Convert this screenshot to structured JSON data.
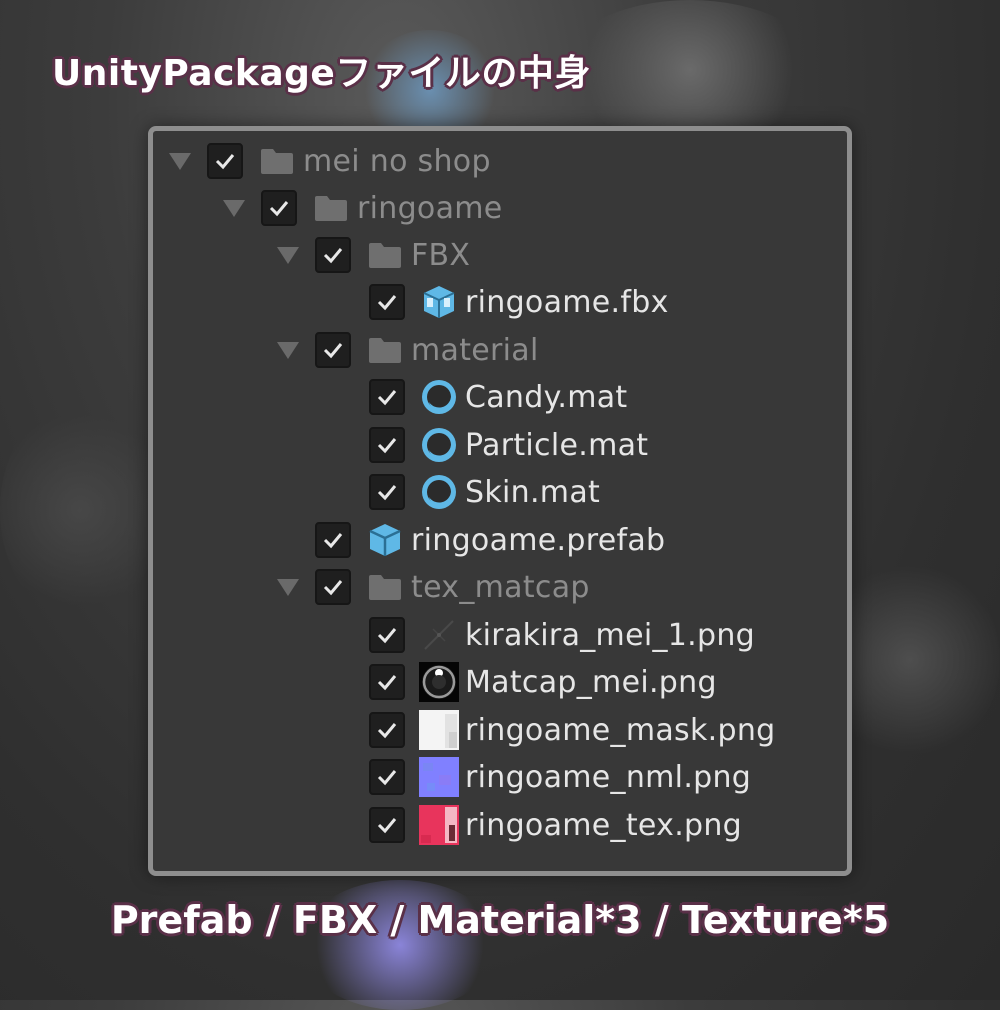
{
  "header": {
    "title": "UnityPackageファイルの中身"
  },
  "footer": {
    "summary": "Prefab / FBX / Material*3 / Texture*5"
  },
  "tree": {
    "root": {
      "label": "mei no shop",
      "checked": true,
      "icon": "folder-icon"
    },
    "ringoame": {
      "label": "ringoame",
      "checked": true,
      "icon": "folder-icon"
    },
    "fbx_folder": {
      "label": "FBX",
      "checked": true,
      "icon": "folder-icon"
    },
    "fbx_file": {
      "label": "ringoame.fbx",
      "checked": true,
      "icon": "model-icon"
    },
    "material_folder": {
      "label": "material",
      "checked": true,
      "icon": "folder-icon"
    },
    "materials": [
      {
        "label": "Candy.mat",
        "checked": true,
        "icon": "material-icon"
      },
      {
        "label": "Particle.mat",
        "checked": true,
        "icon": "material-icon"
      },
      {
        "label": "Skin.mat",
        "checked": true,
        "icon": "material-icon"
      }
    ],
    "prefab": {
      "label": "ringoame.prefab",
      "checked": true,
      "icon": "prefab-icon"
    },
    "tex_folder": {
      "label": "tex_matcap",
      "checked": true,
      "icon": "folder-icon"
    },
    "textures": [
      {
        "label": "kirakira_mei_1.png",
        "checked": true,
        "icon": "sparkle-texture-icon"
      },
      {
        "label": "Matcap_mei.png",
        "checked": true,
        "icon": "matcap-texture-icon"
      },
      {
        "label": "ringoame_mask.png",
        "checked": true,
        "icon": "mask-texture-icon"
      },
      {
        "label": "ringoame_nml.png",
        "checked": true,
        "icon": "normal-map-texture-icon"
      },
      {
        "label": "ringoame_tex.png",
        "checked": true,
        "icon": "albedo-texture-icon"
      }
    ]
  },
  "colors": {
    "panel_bg": "#383838",
    "panel_border": "#8e8e8e",
    "folder_icon": "#6f6f6f",
    "unity_asset_blue": "#5fb8e6",
    "title_outline": "#5a3048"
  }
}
